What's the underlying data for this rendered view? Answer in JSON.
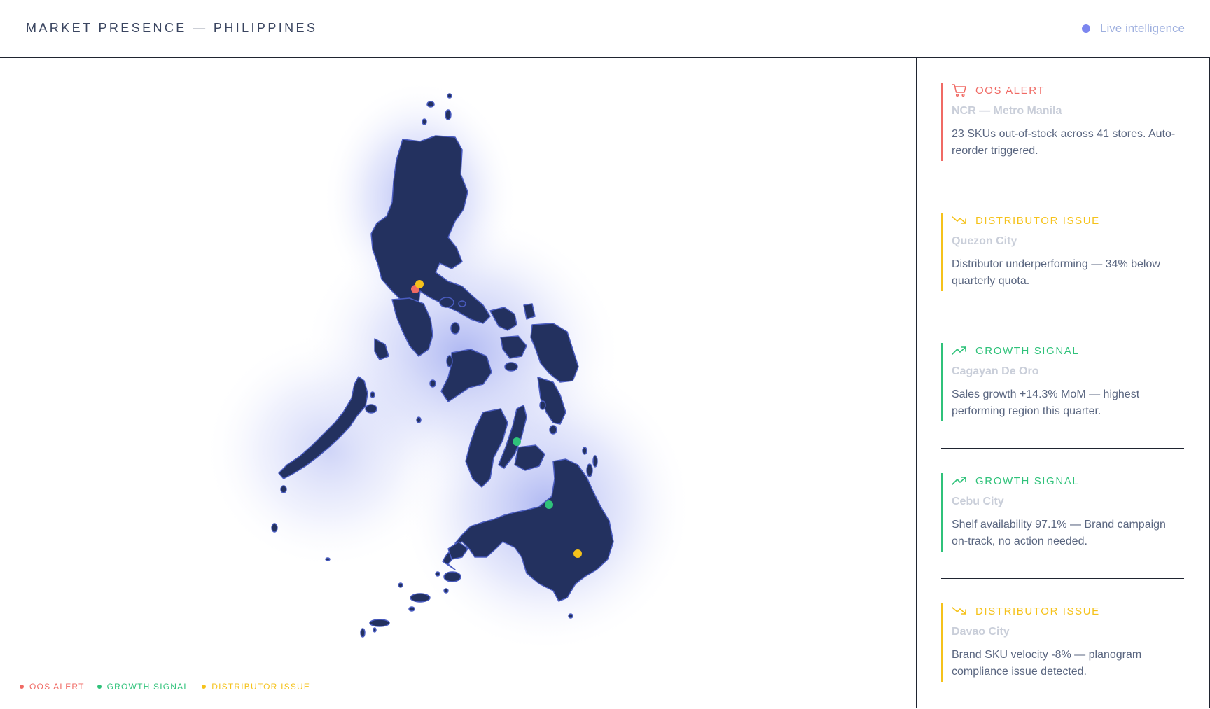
{
  "header": {
    "title": "MARKET PRESENCE — PHILIPPINES",
    "live_label": "Live intelligence"
  },
  "colors": {
    "oos": "#f06a64",
    "growth": "#2fc27a",
    "distributor": "#f5c21b",
    "land": "#23315f",
    "land_stroke": "#4a5cc0",
    "glow": "#6f7fe8"
  },
  "legend": [
    {
      "label": "OOS ALERT",
      "color": "#f06a64"
    },
    {
      "label": "GROWTH SIGNAL",
      "color": "#2fc27a"
    },
    {
      "label": "DISTRIBUTOR ISSUE",
      "color": "#f5c21b"
    }
  ],
  "alerts": [
    {
      "type": "OOS ALERT",
      "icon": "cart-icon",
      "color": "#f06a64",
      "location": "NCR — Metro Manila",
      "description": "23 SKUs out-of-stock across 41 stores. Auto-reorder triggered."
    },
    {
      "type": "DISTRIBUTOR ISSUE",
      "icon": "trend-down-icon",
      "color": "#f5c21b",
      "location": "Quezon City",
      "description": "Distributor underperforming — 34% below quarterly quota."
    },
    {
      "type": "GROWTH SIGNAL",
      "icon": "trend-up-icon",
      "color": "#2fc27a",
      "location": "Cagayan De Oro",
      "description": "Sales growth +14.3% MoM — highest performing region this quarter."
    },
    {
      "type": "GROWTH SIGNAL",
      "icon": "trend-up-icon",
      "color": "#2fc27a",
      "location": "Cebu City",
      "description": "Shelf availability 97.1% — Brand campaign on-track, no action needed."
    },
    {
      "type": "DISTRIBUTOR ISSUE",
      "icon": "trend-down-icon",
      "color": "#f5c21b",
      "location": "Davao City",
      "description": "Brand SKU velocity -8% — planogram compliance issue detected."
    }
  ]
}
